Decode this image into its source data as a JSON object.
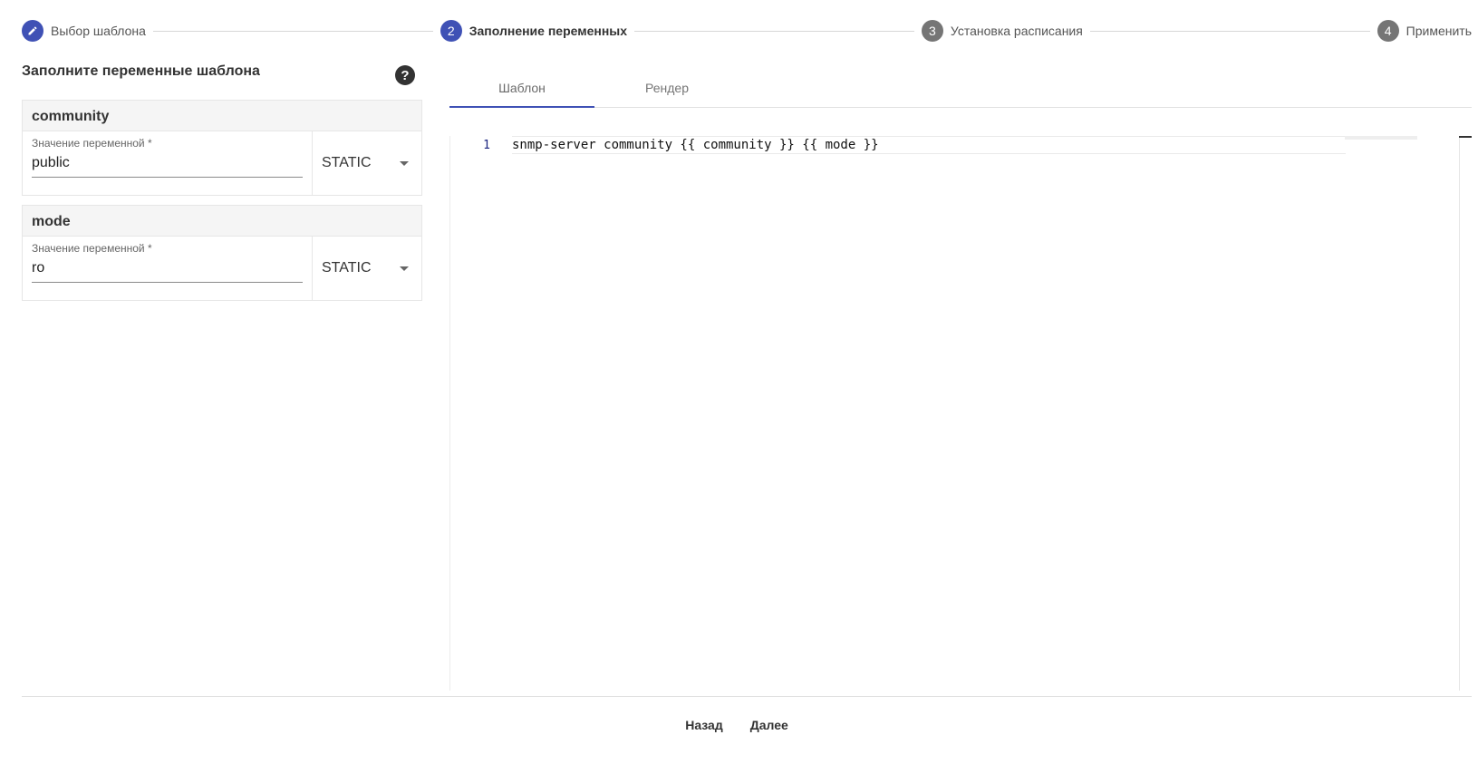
{
  "stepper": {
    "steps": [
      {
        "number": "",
        "label": "Выбор шаблона",
        "state": "done"
      },
      {
        "number": "2",
        "label": "Заполнение переменных",
        "state": "active"
      },
      {
        "number": "3",
        "label": "Установка расписания",
        "state": "todo"
      },
      {
        "number": "4",
        "label": "Применить",
        "state": "todo"
      }
    ],
    "accent_color": "#3f51b5"
  },
  "left": {
    "title": "Заполните переменные шаблона",
    "help_icon": "?",
    "variables": [
      {
        "name": "community",
        "input_label": "Значение переменной *",
        "value": "public",
        "type": "STATIC"
      },
      {
        "name": "mode",
        "input_label": "Значение переменной *",
        "value": "ro",
        "type": "STATIC"
      }
    ]
  },
  "tabs": [
    {
      "label": "Шаблон",
      "active": true
    },
    {
      "label": "Рендер",
      "active": false
    }
  ],
  "editor": {
    "lines": [
      {
        "number": "1",
        "text": "snmp-server community {{ community }} {{ mode }}"
      }
    ]
  },
  "footer": {
    "back_label": "Назад",
    "next_label": "Далее"
  }
}
